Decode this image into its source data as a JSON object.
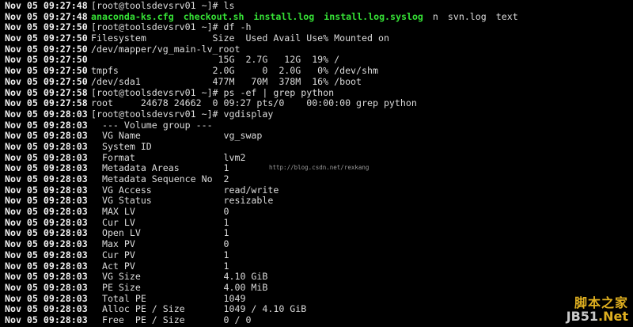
{
  "terminal": {
    "colors": {
      "background": "#000000",
      "text": "#dcdcdc",
      "timestamp": "#f2f2f2",
      "executable": "#36e236"
    },
    "lines": [
      {
        "ts": "Nov 05 09:27:48",
        "text": "[root@toolsdevsrv01 ~]# ls"
      },
      {
        "ts": "Nov 05 09:27:48",
        "tokens": [
          {
            "text": "anaconda-ks.cfg",
            "kind": "exec"
          },
          {
            "text": "checkout.sh",
            "kind": "exec"
          },
          {
            "text": "install.log",
            "kind": "exec"
          },
          {
            "text": "install.log.syslog",
            "kind": "exec"
          },
          {
            "text": "n",
            "kind": "plain"
          },
          {
            "text": "svn.log",
            "kind": "plain"
          },
          {
            "text": "text",
            "kind": "plain"
          }
        ]
      },
      {
        "ts": "Nov 05 09:27:50",
        "text": "[root@toolsdevsrv01 ~]# df -h"
      },
      {
        "ts": "Nov 05 09:27:50",
        "text": "Filesystem            Size  Used Avail Use% Mounted on"
      },
      {
        "ts": "Nov 05 09:27:50",
        "text": "/dev/mapper/vg_main-lv_root"
      },
      {
        "ts": "Nov 05 09:27:50",
        "text": "                       15G  2.7G   12G  19% /"
      },
      {
        "ts": "Nov 05 09:27:50",
        "text": "tmpfs                 2.0G     0  2.0G   0% /dev/shm"
      },
      {
        "ts": "Nov 05 09:27:50",
        "text": "/dev/sda1             477M   70M  378M  16% /boot"
      },
      {
        "ts": "Nov 05 09:27:58",
        "text": "[root@toolsdevsrv01 ~]# ps -ef | grep python"
      },
      {
        "ts": "Nov 05 09:27:58",
        "text": "root     24678 24662  0 09:27 pts/0    00:00:00 grep python"
      },
      {
        "ts": "Nov 05 09:28:03",
        "text": "[root@toolsdevsrv01 ~]# vgdisplay"
      },
      {
        "ts": "Nov 05 09:28:03",
        "text": "  --- Volume group ---"
      },
      {
        "ts": "Nov 05 09:28:03",
        "text": "  VG Name               vg_swap"
      },
      {
        "ts": "Nov 05 09:28:03",
        "text": "  System ID"
      },
      {
        "ts": "Nov 05 09:28:03",
        "text": "  Format                lvm2"
      },
      {
        "ts": "Nov 05 09:28:03",
        "text": "  Metadata Areas        1"
      },
      {
        "ts": "Nov 05 09:28:03",
        "text": "  Metadata Sequence No  2"
      },
      {
        "ts": "Nov 05 09:28:03",
        "text": "  VG Access             read/write"
      },
      {
        "ts": "Nov 05 09:28:03",
        "text": "  VG Status             resizable"
      },
      {
        "ts": "Nov 05 09:28:03",
        "text": "  MAX LV                0"
      },
      {
        "ts": "Nov 05 09:28:03",
        "text": "  Cur LV                1"
      },
      {
        "ts": "Nov 05 09:28:03",
        "text": "  Open LV               1"
      },
      {
        "ts": "Nov 05 09:28:03",
        "text": "  Max PV                0"
      },
      {
        "ts": "Nov 05 09:28:03",
        "text": "  Cur PV                1"
      },
      {
        "ts": "Nov 05 09:28:03",
        "text": "  Act PV                1"
      },
      {
        "ts": "Nov 05 09:28:03",
        "text": "  VG Size               4.10 GiB"
      },
      {
        "ts": "Nov 05 09:28:03",
        "text": "  PE Size               4.00 MiB"
      },
      {
        "ts": "Nov 05 09:28:03",
        "text": "  Total PE              1049"
      },
      {
        "ts": "Nov 05 09:28:03",
        "text": "  Alloc PE / Size       1049 / 4.10 GiB"
      },
      {
        "ts": "Nov 05 09:28:03",
        "text": "  Free  PE / Size       0 / 0"
      }
    ]
  },
  "watermark": "http://blog.csdn.net/rexkang",
  "logo": {
    "top": "脚本之家",
    "bottom": "JB51",
    "suffix": ".Net"
  }
}
